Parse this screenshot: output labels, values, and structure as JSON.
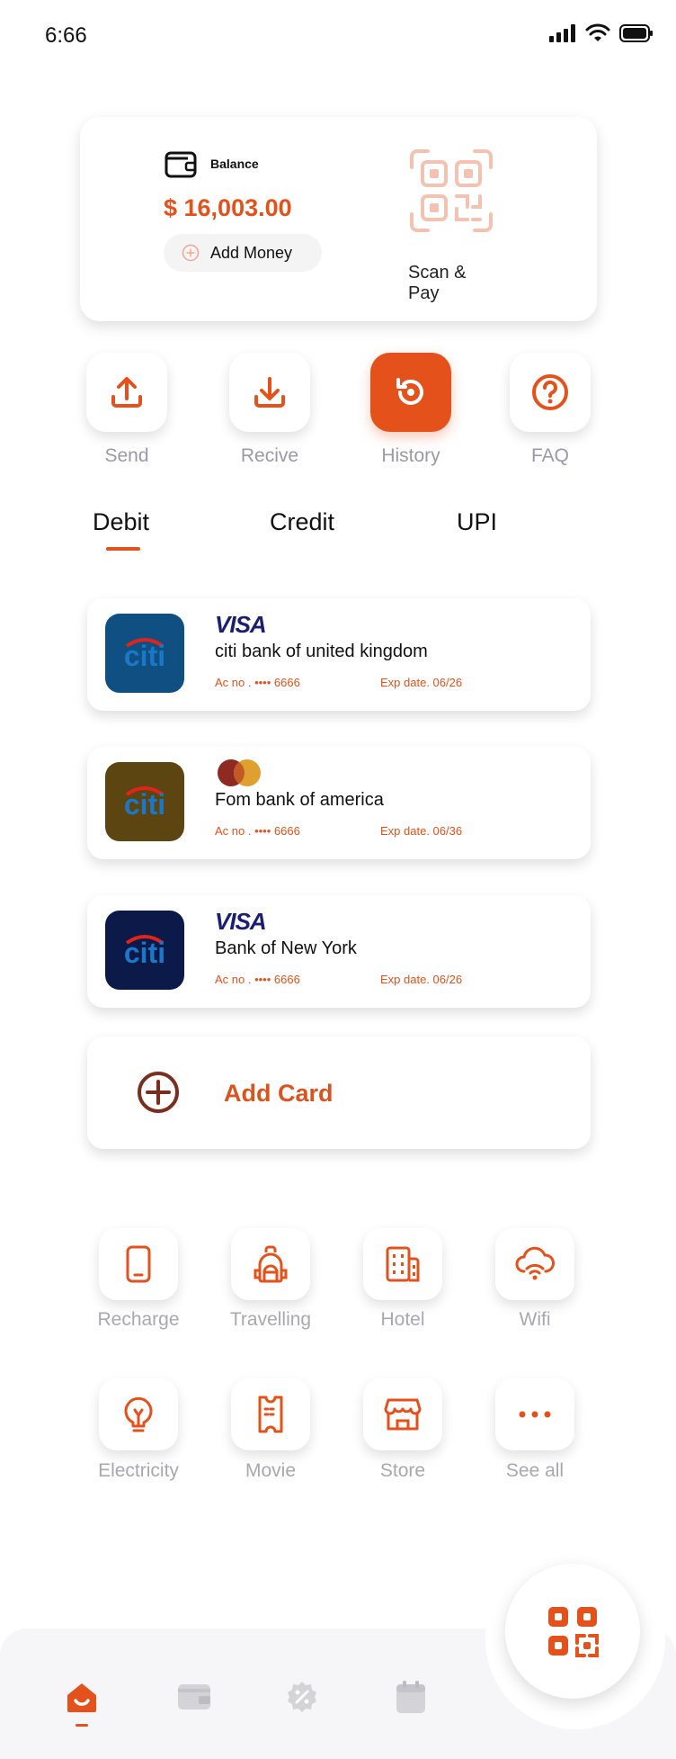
{
  "status_bar": {
    "time": "6:66"
  },
  "balance_card": {
    "label": "Balance",
    "amount": "$ 16,003.00",
    "add_money_label": "Add Money",
    "scan_label": "Scan & Pay"
  },
  "quick_actions": [
    {
      "label": "Send",
      "icon": "upload-icon"
    },
    {
      "label": "Recive",
      "icon": "download-icon"
    },
    {
      "label": "History",
      "icon": "history-icon",
      "active": true
    },
    {
      "label": "FAQ",
      "icon": "question-icon"
    }
  ],
  "tabs": [
    {
      "label": "Debit",
      "selected": true
    },
    {
      "label": "Credit"
    },
    {
      "label": "UPI"
    }
  ],
  "cards": [
    {
      "brand": "VISA",
      "brand_icon": "visa-logo",
      "logo_text": "citi",
      "bank_name": "citi bank of united kingdom",
      "ac_no": "Ac no . •••• 6666",
      "exp": "Exp date. 06/26",
      "logo_color": "#0f4f82"
    },
    {
      "brand": "",
      "brand_icon": "mastercard-logo",
      "logo_text": "citi",
      "bank_name": "Fom bank of america",
      "ac_no": "Ac no . •••• 6666",
      "exp": "Exp date. 06/36",
      "logo_color": "#5d4512"
    },
    {
      "brand": "VISA",
      "brand_icon": "visa-logo",
      "logo_text": "citi",
      "bank_name": "Bank of New York",
      "ac_no": "Ac no . •••• 6666",
      "exp": "Exp date. 06/26",
      "logo_color": "#0c1a4a"
    }
  ],
  "add_card_label": "Add Card",
  "services": [
    {
      "label": "Recharge",
      "icon": "phone-icon"
    },
    {
      "label": "Travelling",
      "icon": "backpack-icon"
    },
    {
      "label": "Hotel",
      "icon": "building-icon"
    },
    {
      "label": "Wifi",
      "icon": "cloud-wifi-icon"
    },
    {
      "label": "Electricity",
      "icon": "bulb-icon"
    },
    {
      "label": "Movie",
      "icon": "ticket-icon"
    },
    {
      "label": "Store",
      "icon": "store-icon"
    },
    {
      "label": "See all",
      "icon": "more-icon"
    }
  ],
  "colors": {
    "accent": "#e4511a",
    "muted": "#9a9aa6"
  }
}
